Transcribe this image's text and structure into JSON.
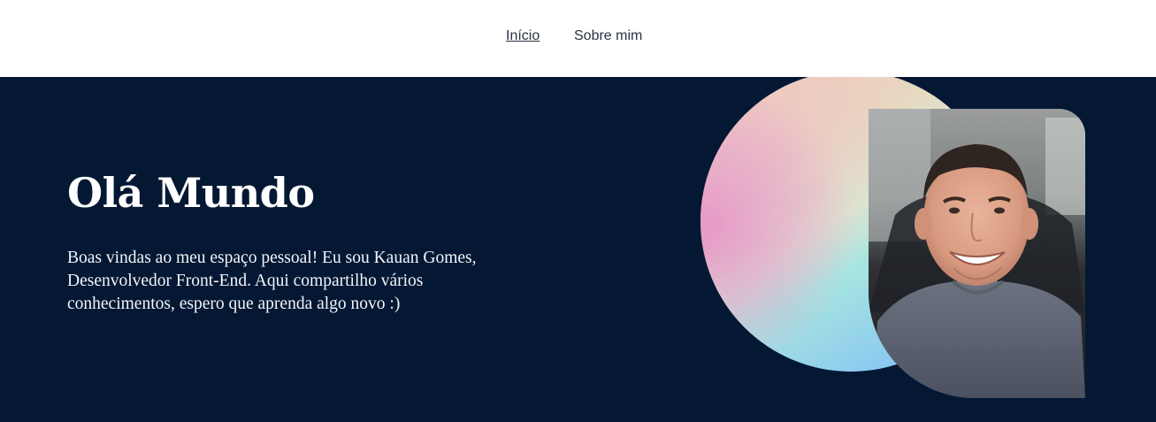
{
  "nav": {
    "items": [
      {
        "label": "Início",
        "active": true
      },
      {
        "label": "Sobre mim",
        "active": false
      }
    ]
  },
  "hero": {
    "title": "Olá Mundo",
    "description": "Boas vindas ao meu espaço pessoal! Eu sou Kauan Gomes, Desenvolvedor Front-End. Aqui compartilho vários conhecimentos, espero que aprenda algo novo :)"
  },
  "colors": {
    "hero_background": "#041834",
    "nav_background": "#ffffff",
    "nav_text": "#2a3142",
    "hero_text": "#ffffff"
  }
}
